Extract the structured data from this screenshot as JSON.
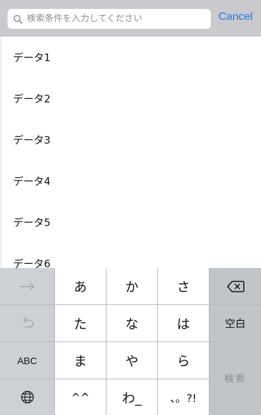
{
  "search": {
    "placeholder": "検索条件を入力してください",
    "value": "",
    "cancel_label": "Cancel"
  },
  "list": {
    "items": [
      {
        "label": "データ1"
      },
      {
        "label": "データ2"
      },
      {
        "label": "データ3"
      },
      {
        "label": "データ4"
      },
      {
        "label": "データ5"
      },
      {
        "label": "データ6"
      }
    ]
  },
  "keyboard": {
    "row1": [
      "あ",
      "か",
      "さ"
    ],
    "row2": [
      "た",
      "な",
      "は"
    ],
    "row3": [
      "ま",
      "や",
      "ら"
    ],
    "row4": [
      "^^",
      "わ_",
      "、。?!"
    ],
    "abc_label": "ABC",
    "space_label": "空白",
    "search_label": "検索",
    "icons": {
      "next": "right-arrow-icon",
      "undo": "undo-icon",
      "globe": "globe-icon",
      "delete": "delete-backspace-icon"
    }
  },
  "colors": {
    "accent": "#1e7cf0",
    "search_bar_bg": "#c9c9ce",
    "keyboard_bg": "#d0d3d8"
  }
}
